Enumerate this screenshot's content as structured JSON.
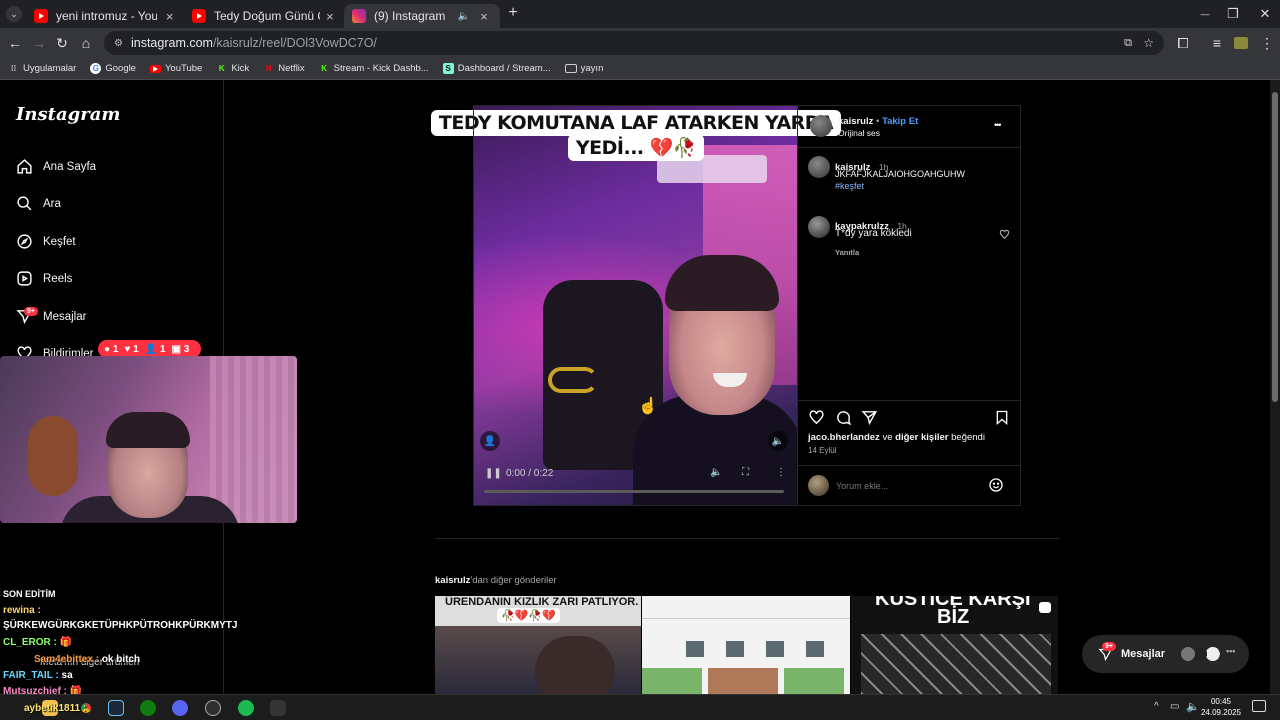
{
  "tabs": [
    {
      "title": "yeni intromuz - YouTube",
      "close": "×"
    },
    {
      "title": "Tedy Doğum Günü Özel Edit - YouTube",
      "close": "×"
    },
    {
      "title": "(9) Instagram",
      "close": "×",
      "speaker": "🔈"
    }
  ],
  "new_tab": "+",
  "window_controls": {
    "minimize": "—",
    "restore": "❐",
    "close": "✕"
  },
  "address": {
    "host": "instagram.com",
    "path": "/kaisrulz/reel/DOl3VowDC7O/"
  },
  "bookmarks": [
    "Uygulamalar",
    "Google",
    "YouTube",
    "Kick",
    "Netflix",
    "Stream - Kick Dashb...",
    "Dashboard / Stream...",
    "yayın"
  ],
  "sidebar": {
    "logo": "Instagram",
    "items": [
      {
        "label": "Ana Sayfa"
      },
      {
        "label": "Ara"
      },
      {
        "label": "Keşfet"
      },
      {
        "label": "Reels"
      },
      {
        "label": "Mesajlar"
      },
      {
        "label": "Bildirimler"
      }
    ],
    "messages_badge": "9+"
  },
  "notifications": {
    "comments": "1",
    "likes": "1",
    "follows": "1",
    "tags": "3"
  },
  "chat": [
    {
      "user": "SON EDİTİM",
      "text": ""
    },
    {
      "user": "rewina :",
      "text": ""
    },
    {
      "user": "",
      "text": "ŞÜRKEWGÜRKGKETÜPHKPÜTROHKPÜRKMYTJ"
    },
    {
      "user": "CL_EROR :",
      "text": "🎁"
    },
    {
      "user": "Sam4ebittex :",
      "text": "ok bitch"
    },
    {
      "user": "FAIR_TAIL :",
      "text": "sa"
    },
    {
      "user": "Mutsuzchief :",
      "text": "🎁"
    },
    {
      "user": "aybetik1811 :",
      "text": ""
    }
  ],
  "chat_overlay_text": "Meta'nın diğer ürünleri",
  "video": {
    "caption_line1": "TEDY KOMUTANA LAF ATARKEN YARRA",
    "caption_line2": "YEDİ... 💔🥀",
    "time": "0:00 / 0:22"
  },
  "post": {
    "author": "kaisrulz",
    "follow": "Takip Et",
    "audio": "Orijinal ses",
    "more": "•••",
    "comments": [
      {
        "user": "kaisrulz",
        "time": "1h",
        "text": "JKFAFJKALJAIOHGOAHGUHW",
        "tag": "#keşfet"
      },
      {
        "user": "kaypakrulzz",
        "time": "1h",
        "text": "T*dy yara kökledi",
        "reply": "Yanıtla"
      }
    ],
    "likes_user": "jaco.bherlandez",
    "likes_connector": "ve",
    "likes_others": "diğer kişiler",
    "likes_suffix": "beğendi",
    "date": "14 Eylül",
    "comment_placeholder": "Yorum ekle..."
  },
  "more_posts": {
    "user": "kaisrulz",
    "suffix": "'dan diğer gönderiler",
    "thumb1_caption": "ÜRENDANIN KIZLIK ZARI PATLIYOR.",
    "thumb1_emoji": "🥀💔🥀💔",
    "thumb3_caption1": "KUSTICE KARŞI",
    "thumb3_caption2": "BİZ"
  },
  "messages_pill": {
    "label": "Mesajlar",
    "badge": "9+"
  },
  "clock": {
    "time": "00:45",
    "date": "24.09.2025"
  }
}
